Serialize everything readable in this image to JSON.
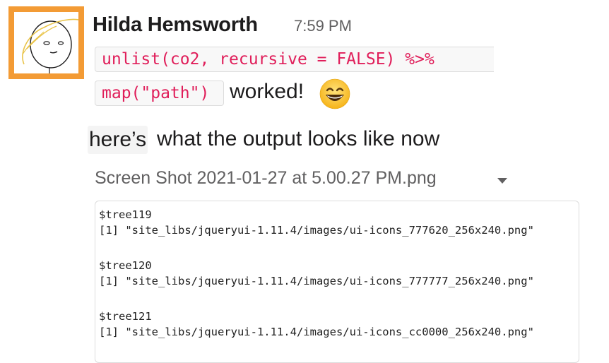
{
  "message": {
    "sender": "Hilda Hemsworth",
    "timestamp": "7:59 PM",
    "code_line_1": "unlist(co2, recursive = FALSE) %>%",
    "code_line_2": "map(\"path\")",
    "text_after_code": "worked!",
    "emoji": "grinning-face-with-smiling-eyes",
    "highlighted_word": "here’s",
    "text_rest": "what the output looks like now"
  },
  "attachment": {
    "filename": "Screen Shot 2021-01-27 at 5.00.27 PM.png",
    "menu_icon": "caret-down-icon",
    "lines": [
      "$tree119",
      "[1] \"site_libs/jqueryui-1.11.4/images/ui-icons_777620_256x240.png\"",
      "",
      "$tree120",
      "[1] \"site_libs/jqueryui-1.11.4/images/ui-icons_777777_256x240.png\"",
      "",
      "$tree121",
      "[1] \"site_libs/jqueryui-1.11.4/images/ui-icons_cc0000_256x240.png\""
    ]
  },
  "colors": {
    "avatar_border": "#f39b35",
    "code_text": "#e01e5a",
    "muted_text": "#616061"
  }
}
